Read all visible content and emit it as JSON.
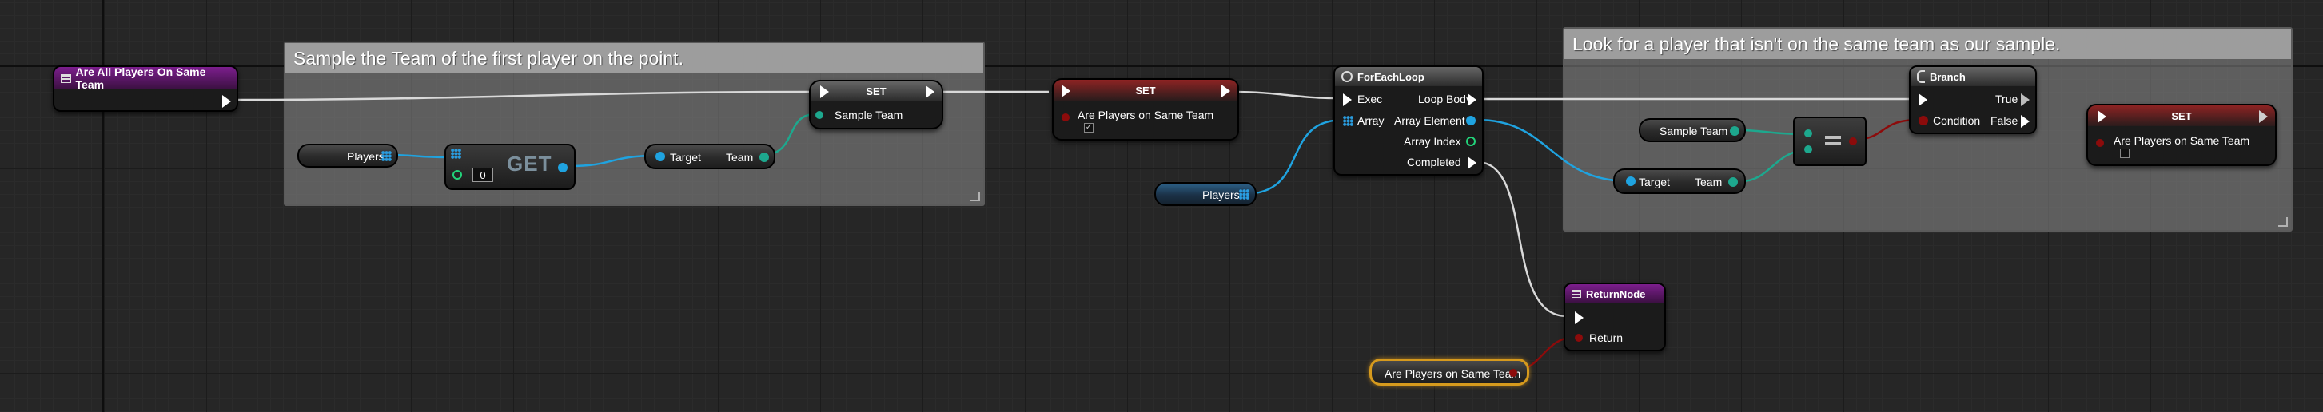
{
  "graph": {
    "comments": [
      {
        "title": "Sample the Team of the first player on the point."
      },
      {
        "title": "Look for a player that isn't on the same team as our sample."
      }
    ],
    "function_entry": {
      "title": "Are All Players On Same Team"
    },
    "players_getter_1": {
      "label": "Players"
    },
    "get_node": {
      "label": "GET",
      "index_value": "0"
    },
    "team_getter_1": {
      "target_label": "Target",
      "output_label": "Team"
    },
    "set_sample_team": {
      "title": "SET",
      "pin_label": "Sample Team"
    },
    "set_are_players_1": {
      "title": "SET",
      "pin_label": "Are Players on Same Team"
    },
    "players_getter_2": {
      "label": "Players"
    },
    "foreach": {
      "title": "ForEachLoop",
      "exec_label": "Exec",
      "array_label": "Array",
      "loop_body_label": "Loop Body",
      "array_element_label": "Array Element",
      "array_index_label": "Array Index",
      "completed_label": "Completed"
    },
    "sample_team_getter": {
      "label": "Sample Team"
    },
    "team_getter_2": {
      "target_label": "Target",
      "output_label": "Team"
    },
    "branch": {
      "title": "Branch",
      "condition_label": "Condition",
      "true_label": "True",
      "false_label": "False"
    },
    "set_are_players_2": {
      "title": "SET",
      "pin_label": "Are Players on Same Team"
    },
    "return_node": {
      "title": "ReturnNode",
      "return_label": "Return"
    },
    "are_players_getter": {
      "label": "Are Players on Same Team"
    }
  },
  "colors": {
    "exec": "#ffffff",
    "object_pin": "#1fa3e0",
    "struct_pin": "#1da88e",
    "bool_pin": "#8c0b0b",
    "int_pin": "#22d37a",
    "selection": "#d69a1d"
  }
}
